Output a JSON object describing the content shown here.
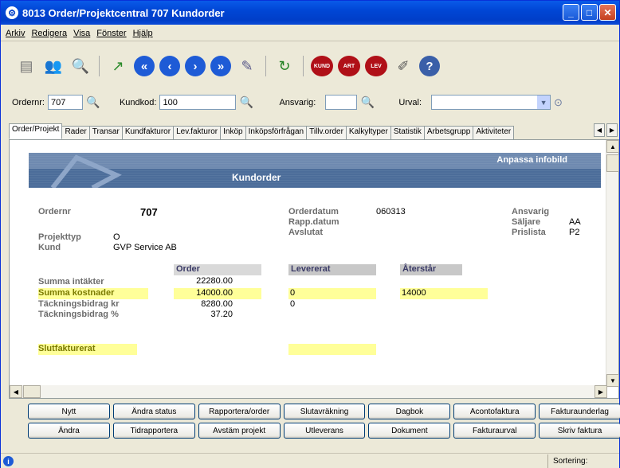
{
  "window": {
    "title": "8013 Order/Projektcentral 707 Kundorder"
  },
  "menu": [
    "Arkiv",
    "Redigera",
    "Visa",
    "Fönster",
    "Hjälp"
  ],
  "toolbar": {
    "red_labels": [
      "KUND",
      "ART",
      "LEV"
    ]
  },
  "filter": {
    "ordernr_label": "Ordernr:",
    "ordernr_value": "707",
    "kundkod_label": "Kundkod:",
    "kundkod_value": "100",
    "ansvarig_label": "Ansvarig:",
    "ansvarig_value": "",
    "urval_label": "Urval:",
    "urval_value": ""
  },
  "tabs": [
    "Order/Projekt",
    "Rader",
    "Transar",
    "Kundfakturor",
    "Lev.fakturor",
    "Inköp",
    "Inköpsförfrågan",
    "Tillv.order",
    "Kalkyltyper",
    "Statistik",
    "Arbetsgrupp",
    "Aktiviteter"
  ],
  "infobox": {
    "anpassa": "Anpassa infobild",
    "heading": "Kundorder",
    "ordernr_label": "Ordernr",
    "ordernr": "707",
    "projekttyp_label": "Projekttyp",
    "projekttyp": "O",
    "kund_label": "Kund",
    "kund": "GVP Service AB",
    "orderdatum_label": "Orderdatum",
    "orderdatum": "060313",
    "rappdatum_label": "Rapp.datum",
    "avslutat_label": "Avslutat",
    "ansvarig_label": "Ansvarig",
    "saljare_label": "Säljare",
    "saljare": "AA",
    "prislista_label": "Prislista",
    "prislista": "P2",
    "col_order": "Order",
    "col_levererat": "Levererat",
    "col_aterstar": "Återstår",
    "summa_intakter_label": "Summa intäkter",
    "summa_intakter": "22280.00",
    "summa_kostnader_label": "Summa kostnader",
    "summa_kostnader": "14000.00",
    "kostnader_lev": "0",
    "kostnader_ater": "14000",
    "tb_kr_label": "Täckningsbidrag kr",
    "tb_kr": "8280.00",
    "tb_kr_lev": "0",
    "tb_pct_label": "Täckningsbidrag %",
    "tb_pct": "37.20",
    "slutfakturerat_label": "Slutfakturerat"
  },
  "buttons_row1": [
    "Nytt",
    "Ändra status",
    "Rapportera/order",
    "Slutavräkning",
    "Dagbok",
    "Acontofaktura",
    "Fakturaunderlag"
  ],
  "buttons_row2": [
    "Ändra",
    "Tidrapportera",
    "Avstäm projekt",
    "Utleverans",
    "Dokument",
    "Fakturaurval",
    "Skriv faktura"
  ],
  "status": {
    "sortering": "Sortering:"
  }
}
